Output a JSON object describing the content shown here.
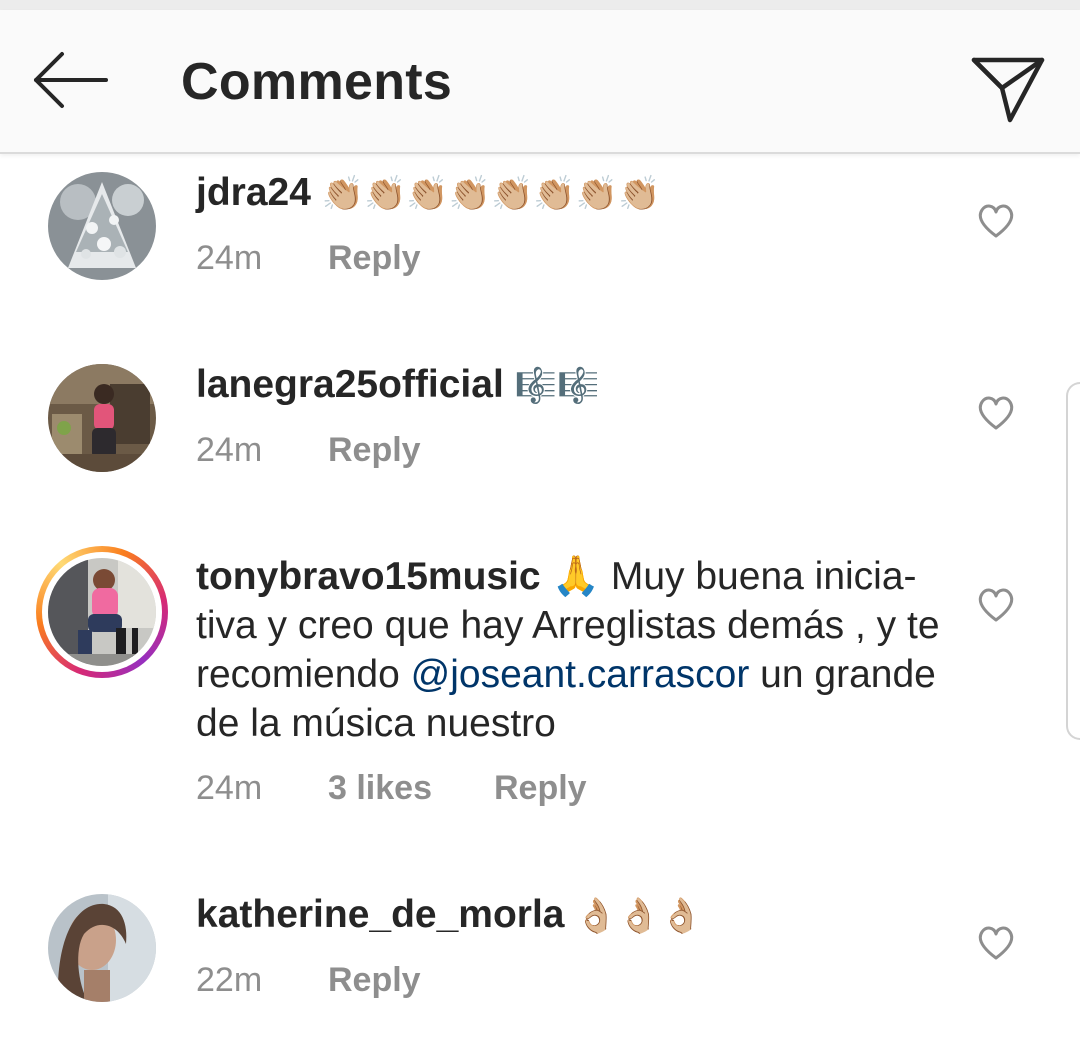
{
  "header": {
    "title": "Comments"
  },
  "comments": [
    {
      "username": "jdra24",
      "text": "👏🏼👏🏼👏🏼👏🏼👏🏼👏🏼👏🏼👏🏼",
      "time": "24m",
      "reply_label": "Reply"
    },
    {
      "username": "lanegra25official",
      "text": "🎼🎼",
      "time": "24m",
      "reply_label": "Reply"
    },
    {
      "username": "tonybravo15music",
      "text_before": " 🙏 Muy buena inicia-tiva y creo que hay Arreglistas demás , y te recomiendo ",
      "mention": "@joseant.carrascor",
      "text_after": " un grande de la música nuestro",
      "time": "24m",
      "likes": "3 likes",
      "reply_label": "Reply"
    },
    {
      "username": "katherine_de_morla",
      "text": "👌🏼👌🏼👌🏼",
      "time": "22m",
      "reply_label": "Reply"
    }
  ],
  "colors": {
    "header_bg": "#fafafa",
    "text": "#262626",
    "meta": "#8e8e8e",
    "mention": "#003569"
  }
}
